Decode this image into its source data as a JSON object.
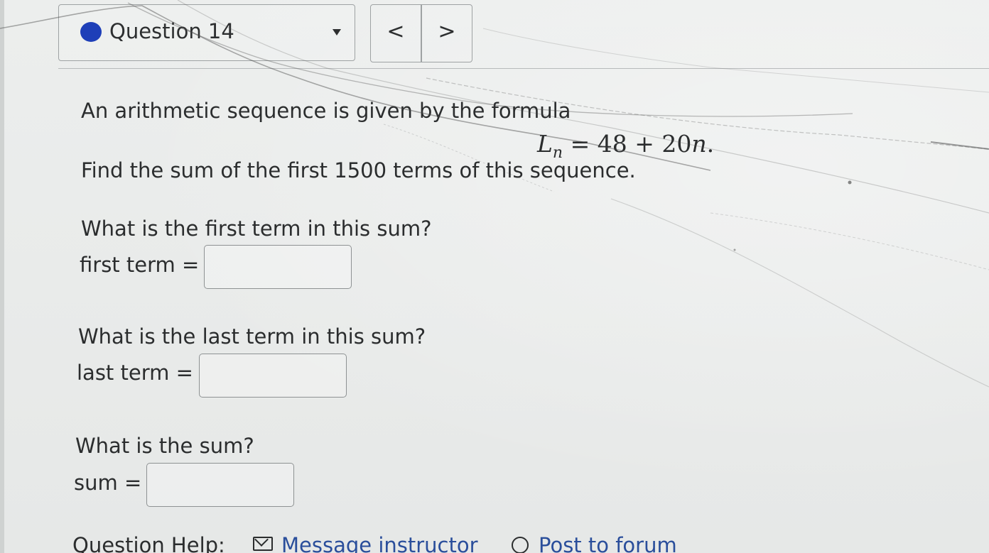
{
  "header": {
    "question_select_label": "Question 14",
    "prev_label": "<",
    "next_label": ">"
  },
  "problem": {
    "intro": "An arithmetic sequence is given by the formula",
    "formula": {
      "lhs_var": "L",
      "lhs_sub": "n",
      "equals": "=",
      "rhs": "48 + 20",
      "rhs_var": "n",
      "end": "."
    },
    "instruction": "Find the sum of the first 1500 terms of this sequence."
  },
  "parts": [
    {
      "question": "What is the first term in this sum?",
      "label": "first term =",
      "value": ""
    },
    {
      "question": "What is the last term in this sum?",
      "label": "last term =",
      "value": ""
    },
    {
      "question": "What is the sum?",
      "label": "sum =",
      "value": ""
    }
  ],
  "help": {
    "label": "Question Help:",
    "message_link": "Message instructor",
    "forum_link": "Post to forum"
  },
  "colors": {
    "status_dot": "#1e3fb8",
    "link": "#2a4e9b",
    "background": "#e9ebea"
  }
}
